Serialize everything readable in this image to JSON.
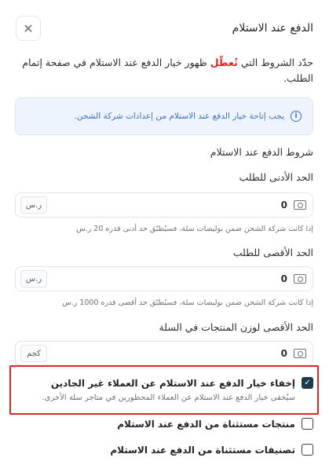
{
  "header": {
    "title": "الدفع عند الاستلام",
    "close_icon": "✕"
  },
  "intro": {
    "before": "حدّد الشروط التي ",
    "highlight": "تُعطّل",
    "after": " ظهور خيار الدفع عند الاستلام في صفحة إتمام الطلب."
  },
  "info": {
    "icon": "i",
    "text": "يجب إتاحة خيار الدفع عند الاستلام من إعدادات شركة الشحن."
  },
  "section_title": "شروط الدفع عند الاستلام",
  "fields": [
    {
      "label": "الحد الأدنى للطلب",
      "value": "0",
      "unit": "ر.س",
      "hint": "إذا كانت شركة الشحن ضمن بوليصات سلة، فسيُطبّق حد أدنى قدره 20 ر.س"
    },
    {
      "label": "الحد الأقصى للطلب",
      "value": "0",
      "unit": "ر.س",
      "hint": "إذا كانت شركة الشحن ضمن بوليصات سلة، فسيُطبّق حد أقصى قدره 1000 ر.س"
    },
    {
      "label": "الحد الأقصى لوزن المنتجات في السلة",
      "value": "0",
      "unit": "كجم",
      "hint": ""
    }
  ],
  "checkboxes": [
    {
      "label": "إخفاء خيار الدفع عند الاستلام عن العملاء غير الجادين",
      "sub": "سيُخفى خيار الدفع عند الاستلام عن العملاء المحظورين في متاجر سلة الأخرى.",
      "checked": true,
      "check_glyph": "✓"
    },
    {
      "label": "منتجات مستثناة من الدفع عند الاستلام",
      "sub": "",
      "checked": false
    },
    {
      "label": "تصنيفات مستثناة من الدفع عند الاستلام",
      "sub": "",
      "checked": false
    }
  ],
  "colors": {
    "accent_red": "#e02424",
    "info_blue": "#3b6fc4",
    "checkbox_checked": "#1e3a4c"
  }
}
